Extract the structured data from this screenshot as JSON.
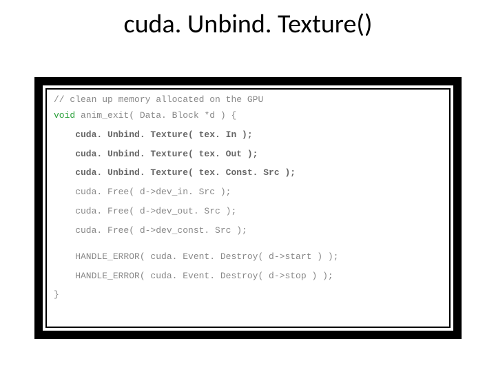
{
  "title": "cuda. Unbind. Texture()",
  "code": {
    "void_kw": "void",
    "lines": [
      "// clean up memory allocated on the GPU",
      " anim_exit( Data. Block *d ) {",
      "    cuda. Unbind. Texture( tex. In );",
      "    cuda. Unbind. Texture( tex. Out );",
      "    cuda. Unbind. Texture( tex. Const. Src );",
      "    cuda. Free( d->dev_in. Src );",
      "    cuda. Free( d->dev_out. Src );",
      "    cuda. Free( d->dev_const. Src );",
      "    HANDLE_ERROR( cuda. Event. Destroy( d->start ) );",
      "    HANDLE_ERROR( cuda. Event. Destroy( d->stop ) );",
      "}"
    ]
  }
}
